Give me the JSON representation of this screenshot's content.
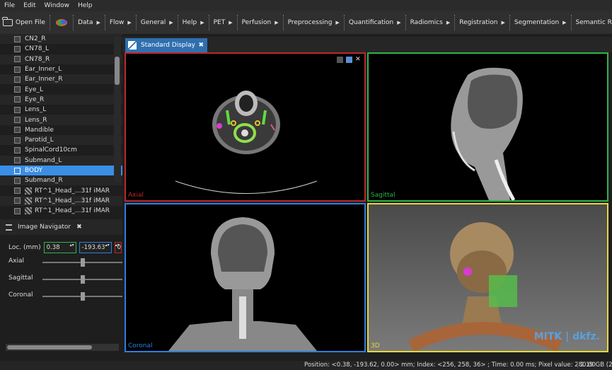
{
  "menubar": [
    "File",
    "Edit",
    "Window",
    "Help"
  ],
  "toolbar": {
    "open_file": "Open File",
    "items": [
      "Data",
      "Flow",
      "General",
      "Help",
      "PET",
      "Perfusion",
      "Preprocessing",
      "Quantification",
      "Radiomics",
      "Registration",
      "Segmentation",
      "Semantic Re"
    ]
  },
  "datamanager": {
    "items": [
      {
        "label": "CN2_R",
        "type": "seg"
      },
      {
        "label": "CN78_L",
        "type": "seg"
      },
      {
        "label": "CN78_R",
        "type": "seg"
      },
      {
        "label": "Ear_Inner_L",
        "type": "seg"
      },
      {
        "label": "Ear_Inner_R",
        "type": "seg"
      },
      {
        "label": "Eye_L",
        "type": "seg"
      },
      {
        "label": "Eye_R",
        "type": "seg"
      },
      {
        "label": "Lens_L",
        "type": "seg"
      },
      {
        "label": "Lens_R",
        "type": "seg"
      },
      {
        "label": "Mandible",
        "type": "seg"
      },
      {
        "label": "Parotid_L",
        "type": "seg"
      },
      {
        "label": "SpinalCord10cm",
        "type": "seg"
      },
      {
        "label": "Submand_L",
        "type": "seg"
      },
      {
        "label": "BODY",
        "type": "seg",
        "selected": true
      },
      {
        "label": "Submand_R",
        "type": "seg"
      },
      {
        "label": "RT^1_Head_...31f",
        "type": "image",
        "modality": "iMAR"
      },
      {
        "label": "RT^1_Head_...31f",
        "type": "image",
        "modality": "iMAR"
      },
      {
        "label": "RT^1_Head_...31f",
        "type": "image",
        "modality": "iMAR"
      }
    ]
  },
  "navigator": {
    "title": "Image Navigator",
    "loc_label": "Loc. (mm)",
    "x": "0.38",
    "y": "-193.63",
    "z": "0.",
    "axial": "Axial",
    "sagittal": "Sagittal",
    "coronal": "Coronal"
  },
  "display": {
    "tab": "Standard Display",
    "views": {
      "axial": "Axial",
      "sagittal": "Sagittal",
      "coronal": "Coronal",
      "threed": "3D"
    },
    "watermark": "MITK | dkfz."
  },
  "status": {
    "text": "Position: <0.38, -193.62, 0.00> mm; Index: <256, 258, 36> ; Time: 0.00 ms; Pixel value: 280.00",
    "memory": "2.19 GB (2"
  },
  "colors": {
    "axial": "#c0262b",
    "sagittal": "#2bb54a",
    "coronal": "#2f7de0",
    "threed": "#e6d83a",
    "selection": "#3a8ee6"
  }
}
